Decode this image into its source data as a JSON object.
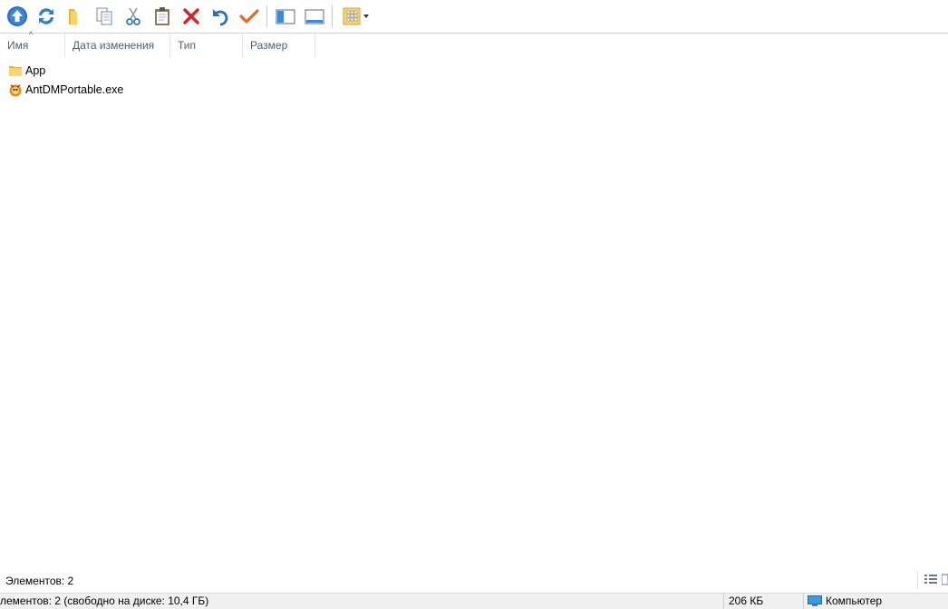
{
  "toolbar": {
    "buttons": [
      {
        "name": "up-icon",
        "color": "#2a6fbf"
      },
      {
        "name": "refresh-icon",
        "color": "#2a7fd4"
      },
      {
        "name": "folder-icon",
        "color": "#f6c74a"
      },
      {
        "name": "copy-icon",
        "color": "#7a8aa0"
      },
      {
        "name": "cut-icon",
        "color": "#3a78c0"
      },
      {
        "name": "paste-icon",
        "color": "#7a6a50"
      },
      {
        "name": "delete-icon",
        "color": "#d8202a"
      },
      {
        "name": "undo-icon",
        "color": "#2a6fbf"
      },
      {
        "name": "checkmark-icon",
        "color": "#e86a1a"
      },
      {
        "name": "panel-left-icon",
        "color": "#3a8ad8"
      },
      {
        "name": "panel-preview-icon",
        "color": "#3a8ad8"
      },
      {
        "name": "view-options-icon",
        "color": "#f0c24a"
      }
    ]
  },
  "columns": {
    "name": "Имя",
    "date": "Дата изменения",
    "type": "Тип",
    "size": "Размер",
    "sort_indicator": "^"
  },
  "files": [
    {
      "name": "App",
      "icon": "folder-icon"
    },
    {
      "name": "AntDMPortable.exe",
      "icon": "app-exe-icon"
    }
  ],
  "status_inner": {
    "items_count": "Элементов: 2"
  },
  "statusbar": {
    "left": "лементов: 2 (свободно на диске: 10,4 ГБ)",
    "size": "206 КБ",
    "location": "Компьютер"
  },
  "colors": {
    "header_text": "#4c607a",
    "accent": "#2a6fbf"
  }
}
